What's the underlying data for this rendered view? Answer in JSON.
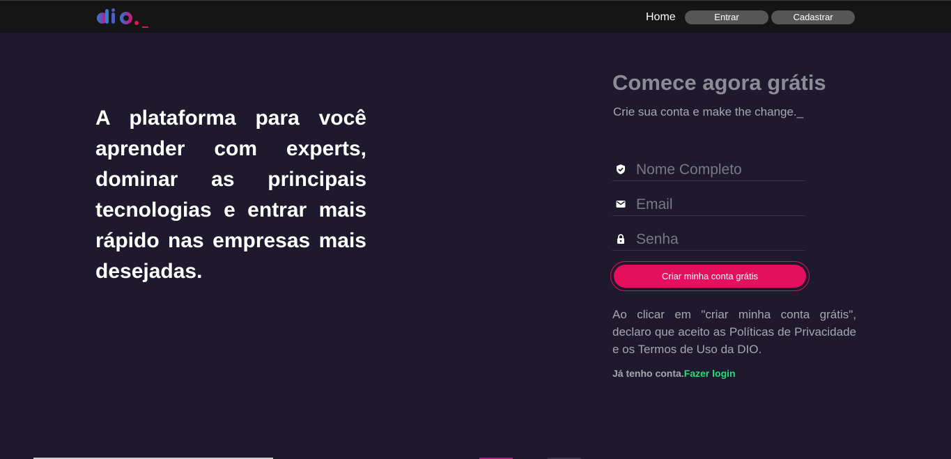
{
  "header": {
    "logo_text": "dio._",
    "nav": {
      "home": "Home",
      "entrar": "Entrar",
      "cadastrar": "Cadastrar"
    }
  },
  "hero": {
    "text": "A plataforma para você aprender com experts, dominar as principais tecnologias e entrar mais rápido nas empresas mais desejadas."
  },
  "form": {
    "title": "Comece agora grátis",
    "subtitle": "Crie sua conta e make the change._",
    "fields": {
      "name": {
        "placeholder": "Nome Completo",
        "value": "",
        "icon": "shield-check-icon"
      },
      "email": {
        "placeholder": "Email",
        "value": "",
        "icon": "mail-icon"
      },
      "senha": {
        "placeholder": "Senha",
        "value": "",
        "icon": "lock-icon"
      }
    },
    "submit_label": "Criar minha conta grátis",
    "terms": "Ao clicar em \"criar minha conta grátis\", declaro que aceito as Políticas de Privacidade e os Termos de Uso da DIO.",
    "login_prefix": "Já tenho conta.",
    "login_link": "Fazer login"
  },
  "colors": {
    "background": "#1e192c",
    "header": "#151515",
    "accent": "#e4105d",
    "link": "#23dd7a",
    "nav_button": "#565656"
  }
}
